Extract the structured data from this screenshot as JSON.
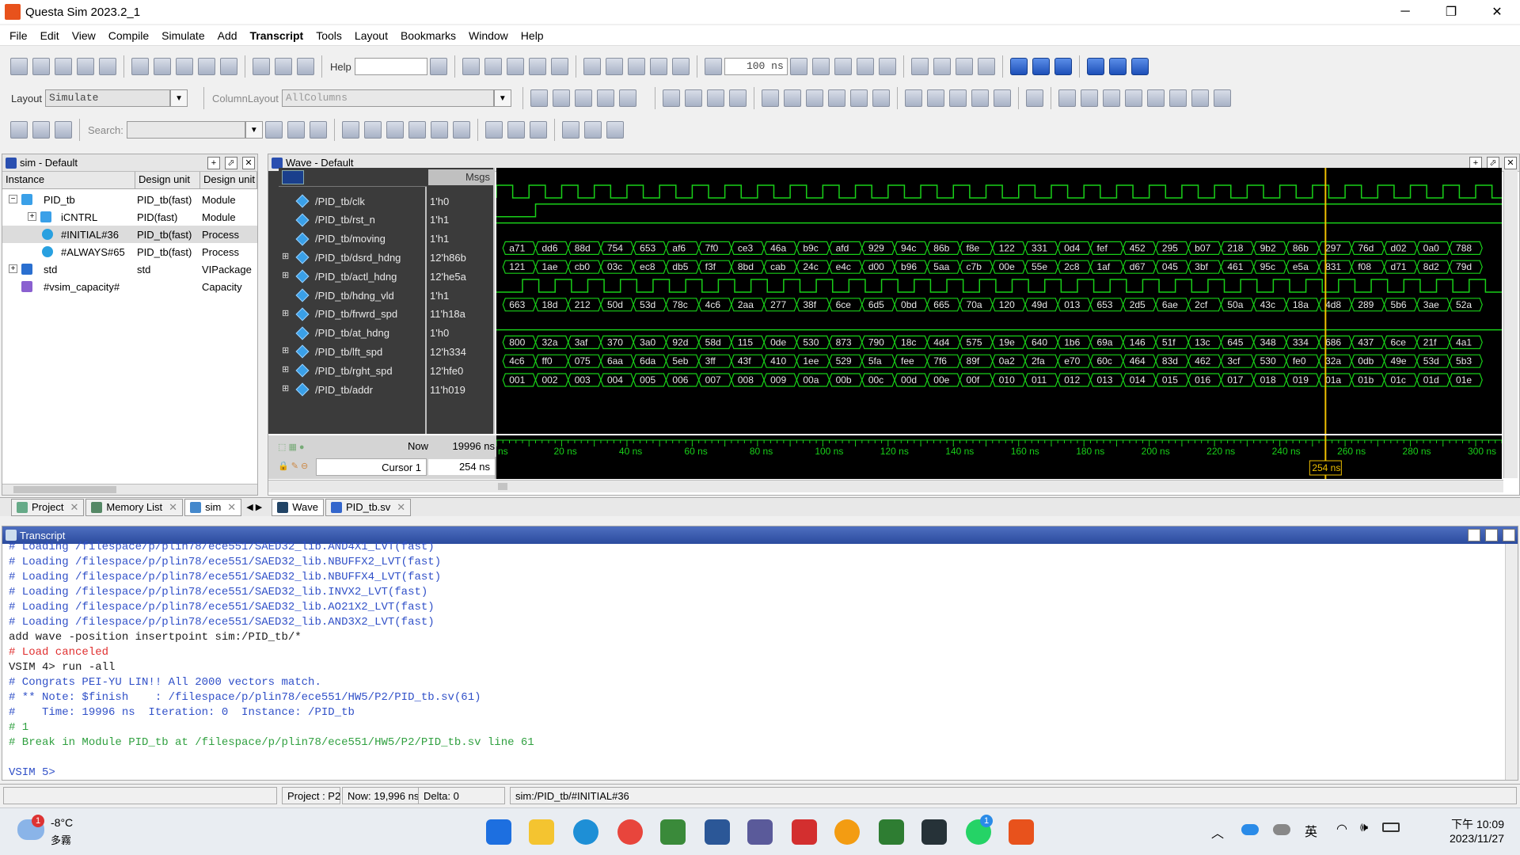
{
  "window": {
    "title": "Questa Sim 2023.2_1"
  },
  "menu": [
    "File",
    "Edit",
    "View",
    "Compile",
    "Simulate",
    "Add",
    "Transcript",
    "Tools",
    "Layout",
    "Bookmarks",
    "Window",
    "Help"
  ],
  "toolbar": {
    "help_label": "Help",
    "time_value": "100 ns",
    "layout_label": "Layout",
    "layout_value": "Simulate",
    "columnlayout_label": "ColumnLayout",
    "columnlayout_value": "AllColumns",
    "search_placeholder": "Search:"
  },
  "instance_panel": {
    "title": "sim - Default",
    "columns": [
      "Instance",
      "Design unit",
      "Design unit ty"
    ],
    "rows": [
      {
        "name": "PID_tb",
        "unit": "PID_tb(fast)",
        "type": "Module"
      },
      {
        "name": "iCNTRL",
        "unit": "PID(fast)",
        "type": "Module"
      },
      {
        "name": "#INITIAL#36",
        "unit": "PID_tb(fast)",
        "type": "Process"
      },
      {
        "name": "#ALWAYS#65",
        "unit": "PID_tb(fast)",
        "type": "Process"
      },
      {
        "name": "std",
        "unit": "std",
        "type": "VIPackage"
      },
      {
        "name": "#vsim_capacity#",
        "unit": "",
        "type": "Capacity"
      }
    ]
  },
  "wave": {
    "title": "Wave - Default",
    "msgs_header": "Msgs",
    "signals": [
      {
        "name": "/PID_tb/clk",
        "value": "1'h0",
        "kind": "clk",
        "exp": false
      },
      {
        "name": "/PID_tb/rst_n",
        "value": "1'h1",
        "kind": "rst",
        "exp": false
      },
      {
        "name": "/PID_tb/moving",
        "value": "1'h1",
        "kind": "high",
        "exp": false
      },
      {
        "name": "/PID_tb/dsrd_hdng",
        "value": "12'h86b",
        "kind": "bus",
        "exp": true,
        "vals": [
          "a71",
          "dd6",
          "88d",
          "754",
          "653",
          "af6",
          "7f0",
          "ce3",
          "46a",
          "b9c",
          "afd",
          "929",
          "94c",
          "86b",
          "f8e",
          "122",
          "331",
          "0d4",
          "fef",
          "452",
          "295",
          "b07",
          "218",
          "9b2",
          "86b",
          "297",
          "76d",
          "d02",
          "0a0",
          "788"
        ]
      },
      {
        "name": "/PID_tb/actl_hdng",
        "value": "12'he5a",
        "kind": "bus",
        "exp": true,
        "vals": [
          "121",
          "1ae",
          "cb0",
          "03c",
          "ec8",
          "db5",
          "f3f",
          "8bd",
          "cab",
          "24c",
          "e4c",
          "d00",
          "b96",
          "5aa",
          "c7b",
          "00e",
          "55e",
          "2c8",
          "1af",
          "d67",
          "045",
          "3bf",
          "461",
          "95c",
          "e5a",
          "831",
          "f08",
          "d71",
          "8d2",
          "79d"
        ]
      },
      {
        "name": "/PID_tb/hdng_vld",
        "value": "1'h1",
        "kind": "vld",
        "exp": false
      },
      {
        "name": "/PID_tb/frwrd_spd",
        "value": "11'h18a",
        "kind": "bus",
        "exp": true,
        "vals": [
          "663",
          "18d",
          "212",
          "50d",
          "53d",
          "78c",
          "4c6",
          "2aa",
          "277",
          "38f",
          "6ce",
          "6d5",
          "0bd",
          "665",
          "70a",
          "120",
          "49d",
          "013",
          "653",
          "2d5",
          "6ae",
          "2cf",
          "50a",
          "43c",
          "18a",
          "4d8",
          "289",
          "5b6",
          "3ae",
          "52a"
        ]
      },
      {
        "name": "/PID_tb/at_hdng",
        "value": "1'h0",
        "kind": "low",
        "exp": false
      },
      {
        "name": "/PID_tb/lft_spd",
        "value": "12'h334",
        "kind": "bus",
        "exp": true,
        "vals": [
          "800",
          "32a",
          "3af",
          "370",
          "3a0",
          "92d",
          "58d",
          "115",
          "0de",
          "530",
          "873",
          "790",
          "18c",
          "4d4",
          "575",
          "19e",
          "640",
          "1b6",
          "69a",
          "146",
          "51f",
          "13c",
          "645",
          "348",
          "334",
          "686",
          "437",
          "6ce",
          "21f",
          "4a1"
        ]
      },
      {
        "name": "/PID_tb/rght_spd",
        "value": "12'hfe0",
        "kind": "bus",
        "exp": true,
        "vals": [
          "4c6",
          "ff0",
          "075",
          "6aa",
          "6da",
          "5eb",
          "3ff",
          "43f",
          "410",
          "1ee",
          "529",
          "5fa",
          "fee",
          "7f6",
          "89f",
          "0a2",
          "2fa",
          "e70",
          "60c",
          "464",
          "83d",
          "462",
          "3cf",
          "530",
          "fe0",
          "32a",
          "0db",
          "49e",
          "53d",
          "5b3"
        ]
      },
      {
        "name": "/PID_tb/addr",
        "value": "11'h019",
        "kind": "bus",
        "exp": true,
        "vals": [
          "001",
          "002",
          "003",
          "004",
          "005",
          "006",
          "007",
          "008",
          "009",
          "00a",
          "00b",
          "00c",
          "00d",
          "00e",
          "00f",
          "010",
          "011",
          "012",
          "013",
          "014",
          "015",
          "016",
          "017",
          "018",
          "019",
          "01a",
          "01b",
          "01c",
          "01d",
          "01e"
        ]
      }
    ],
    "now_label": "Now",
    "now_value": "19996 ns",
    "cursor_label": "Cursor 1",
    "cursor_value": "254 ns",
    "cursor_flag": "254 ns",
    "timeline": [
      "ns",
      "20 ns",
      "40 ns",
      "60 ns",
      "80 ns",
      "100 ns",
      "120 ns",
      "140 ns",
      "160 ns",
      "180 ns",
      "200 ns",
      "220 ns",
      "240 ns",
      "260 ns",
      "280 ns",
      "300 ns"
    ]
  },
  "tabs": {
    "left": [
      "Project",
      "Memory List",
      "sim"
    ],
    "right": [
      "Wave",
      "PID_tb.sv"
    ]
  },
  "transcript": {
    "title": "Transcript",
    "lines": [
      {
        "t": "# Loading /filespace/p/plin78/ece551/SAED32_lib.AND4X1_LVT(fast)",
        "c": "#3050c8"
      },
      {
        "t": "# Loading /filespace/p/plin78/ece551/SAED32_lib.NBUFFX2_LVT(fast)",
        "c": "#3050c8"
      },
      {
        "t": "# Loading /filespace/p/plin78/ece551/SAED32_lib.NBUFFX4_LVT(fast)",
        "c": "#3050c8"
      },
      {
        "t": "# Loading /filespace/p/plin78/ece551/SAED32_lib.INVX2_LVT(fast)",
        "c": "#3050c8"
      },
      {
        "t": "# Loading /filespace/p/plin78/ece551/SAED32_lib.AO21X2_LVT(fast)",
        "c": "#3050c8"
      },
      {
        "t": "# Loading /filespace/p/plin78/ece551/SAED32_lib.AND3X2_LVT(fast)",
        "c": "#3050c8"
      },
      {
        "t": "add wave -position insertpoint sim:/PID_tb/*",
        "c": "#202020"
      },
      {
        "t": "# Load canceled",
        "c": "#e03030"
      },
      {
        "t": "VSIM 4> run -all",
        "c": "#202020"
      },
      {
        "t": "# Congrats PEI-YU LIN!! All 2000 vectors match.",
        "c": "#3050c8"
      },
      {
        "t": "# ** Note: $finish    : /filespace/p/plin78/ece551/HW5/P2/PID_tb.sv(61)",
        "c": "#3050c8"
      },
      {
        "t": "#    Time: 19996 ns  Iteration: 0  Instance: /PID_tb",
        "c": "#3050c8"
      },
      {
        "t": "# 1",
        "c": "#30a040"
      },
      {
        "t": "# Break in Module PID_tb at /filespace/p/plin78/ece551/HW5/P2/PID_tb.sv line 61",
        "c": "#30a040"
      },
      {
        "t": "",
        "c": "#000"
      },
      {
        "t": "VSIM 5>",
        "c": "#3050c8"
      }
    ]
  },
  "status": {
    "project": "Project : P2",
    "now": "Now: 19,996 ns",
    "delta": "Delta: 0",
    "scope": "sim:/PID_tb/#INITIAL#36"
  },
  "taskbar": {
    "temp": "-8°C",
    "weather": "多霧",
    "badge": "1",
    "time": "下午 10:09",
    "date": "2023/11/27",
    "lang": "英",
    "whatsapp_badge": "1"
  },
  "colors": {
    "wave_green": "#19d019",
    "cursor": "#f0c000",
    "accent_blue": "#2b4b9e"
  }
}
